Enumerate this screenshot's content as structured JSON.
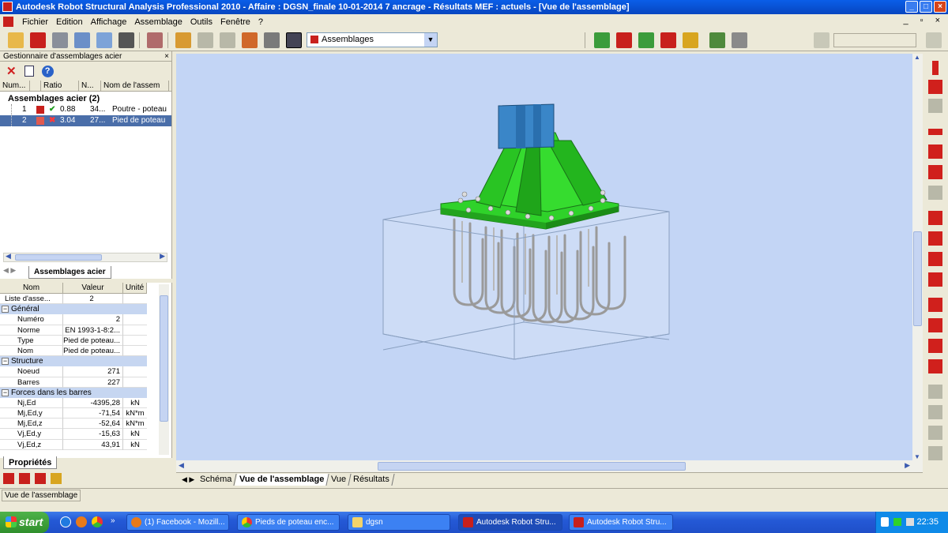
{
  "window": {
    "title": "Autodesk Robot Structural Analysis Professional 2010 - Affaire : DGSN_finale 10-01-2014 7 ancrage - Résultats MEF : actuels - [Vue de l'assemblage]"
  },
  "menu": {
    "items": [
      "Fichier",
      "Edition",
      "Affichage",
      "Assemblage",
      "Outils",
      "Fenêtre",
      "?"
    ],
    "right_controls": "_ ▫ ×"
  },
  "toolbar": {
    "combo_value": "Assemblages"
  },
  "manager": {
    "title": "Gestionnaire d'assemblages acier",
    "close": "×",
    "columns": [
      "Num...",
      "Ratio",
      "N...",
      "Nom de l'assem"
    ],
    "root": "Assemblages acier (2)",
    "rows": [
      {
        "num": "1",
        "ratio": "0.88",
        "n": "34...",
        "name": "Poutre - poteau",
        "status": "ok"
      },
      {
        "num": "2",
        "ratio": "3.04",
        "n": "27...",
        "name": "Pied de poteau",
        "status": "fail"
      }
    ],
    "tab": "Assemblages acier"
  },
  "properties": {
    "columns": [
      "Nom",
      "Valeur",
      "Unité"
    ],
    "list_label": "Liste d'asse...",
    "list_value": "2",
    "groups": [
      {
        "name": "Général",
        "rows": [
          {
            "k": "Numéro",
            "v": "2",
            "u": ""
          },
          {
            "k": "Norme",
            "v": "EN 1993-1-8:2...",
            "u": ""
          },
          {
            "k": "Type",
            "v": "Pied de poteau...",
            "u": ""
          },
          {
            "k": "Nom",
            "v": "Pied de poteau...",
            "u": ""
          }
        ]
      },
      {
        "name": "Structure",
        "rows": [
          {
            "k": "Noeud",
            "v": "271",
            "u": ""
          },
          {
            "k": "Barres",
            "v": "227",
            "u": ""
          }
        ]
      },
      {
        "name": "Forces dans les barres",
        "rows": [
          {
            "k": "Nj,Ed",
            "v": "-4395,28",
            "u": "kN"
          },
          {
            "k": "Mj,Ed,y",
            "v": "-71,54",
            "u": "kN*m"
          },
          {
            "k": "Mj,Ed,z",
            "v": "-52,64",
            "u": "kN*m"
          },
          {
            "k": "Vj,Ed,y",
            "v": "-15,63",
            "u": "kN"
          },
          {
            "k": "Vj,Ed,z",
            "v": "43,91",
            "u": "kN"
          }
        ]
      }
    ],
    "tab": "Propriétés"
  },
  "view_tabs": [
    "Schéma",
    "Vue de l'assemblage",
    "Vue",
    "Résultats"
  ],
  "status": {
    "text": "Vue de l'assemblage"
  },
  "taskbar": {
    "start": "start",
    "buttons": [
      "(1) Facebook - Mozill...",
      "Pieds de poteau enc...",
      "dgsn",
      "Autodesk Robot Stru...",
      "Autodesk Robot Stru..."
    ],
    "clock": "22:35"
  },
  "colors": {
    "steel_green": "#2fd22a",
    "column_blue": "#3a86c8",
    "viewport_bg": "#c3d5f5",
    "selection": "#4a6ea9"
  }
}
